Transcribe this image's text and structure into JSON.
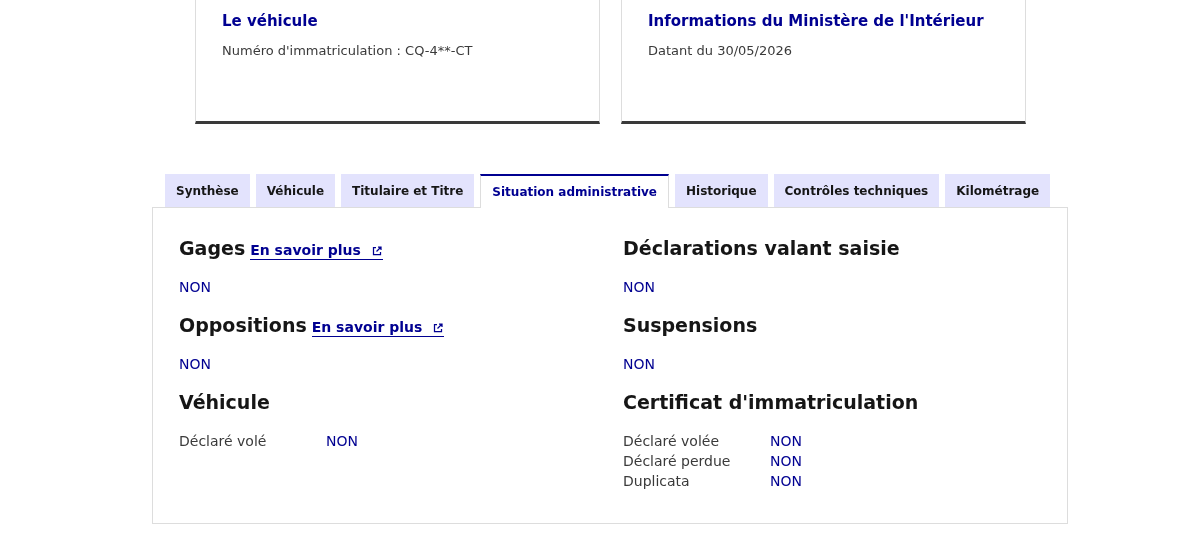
{
  "cards": [
    {
      "title": "Le véhicule",
      "text": "Numéro d'immatriculation : CQ-4**-CT"
    },
    {
      "title": "Informations du Ministère de l'Intérieur",
      "text": "Datant du 30/05/2026"
    }
  ],
  "tabs": [
    {
      "label": "Synthèse",
      "selected": false
    },
    {
      "label": "Véhicule",
      "selected": false
    },
    {
      "label": "Titulaire et Titre",
      "selected": false
    },
    {
      "label": "Situation administrative",
      "selected": true
    },
    {
      "label": "Historique",
      "selected": false
    },
    {
      "label": "Contrôles techniques",
      "selected": false
    },
    {
      "label": "Kilométrage",
      "selected": false
    }
  ],
  "columns": [
    [
      {
        "kind": "value",
        "title": "Gages",
        "link": "En savoir plus",
        "value": "NON"
      },
      {
        "kind": "value",
        "title": "Oppositions",
        "link": "En savoir plus",
        "value": "NON"
      },
      {
        "kind": "table",
        "title": "Véhicule",
        "rows": [
          {
            "label": "Déclaré volé",
            "value": "NON"
          }
        ]
      }
    ],
    [
      {
        "kind": "value",
        "title": "Déclarations valant saisie",
        "value": "NON"
      },
      {
        "kind": "value",
        "title": "Suspensions",
        "value": "NON"
      },
      {
        "kind": "table",
        "title": "Certificat d'immatriculation",
        "rows": [
          {
            "label": "Déclaré volée",
            "value": "NON"
          },
          {
            "label": "Déclaré perdue",
            "value": "NON"
          },
          {
            "label": "Duplicata",
            "value": "NON"
          }
        ]
      }
    ]
  ]
}
